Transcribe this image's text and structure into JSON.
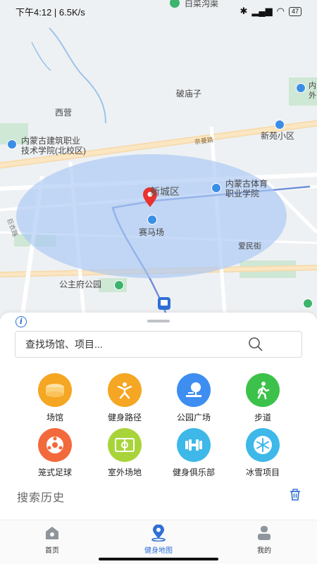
{
  "status": {
    "time_speed": "下午4:12 | 6.5K/s",
    "battery": "47"
  },
  "map": {
    "labels": {
      "top": "白菜沟渠",
      "xiying": "西营",
      "pomiaozi": "破庙子",
      "jianzhu": "内蒙古建筑职业\n技术学院(北校区)",
      "xinyuan": "新苑小区",
      "district": "新城区",
      "tiyu": "内蒙古体育\n职业学院",
      "saimachang": "赛马场",
      "gongzhufu": "公主府公园",
      "aimin": "爱民街",
      "neimeng_edge": "内\n外",
      "road": "奈曼路",
      "road2": "巨衣路"
    }
  },
  "sheet": {
    "search_placeholder": "查找场馆、项目...",
    "categories": [
      {
        "label": "场馆",
        "color": "#f5a623",
        "icon": "stadium-icon"
      },
      {
        "label": "健身路径",
        "color": "#f5a623",
        "icon": "fitness-path-icon"
      },
      {
        "label": "公园广场",
        "color": "#3d8ef0",
        "icon": "park-icon"
      },
      {
        "label": "步道",
        "color": "#3cc24a",
        "icon": "walking-icon"
      },
      {
        "label": "笼式足球",
        "color": "#f2693b",
        "icon": "football-icon"
      },
      {
        "label": "室外场地",
        "color": "#a8d43a",
        "icon": "outdoor-field-icon"
      },
      {
        "label": "健身俱乐部",
        "color": "#3db8e8",
        "icon": "dumbbell-icon"
      },
      {
        "label": "冰雪项目",
        "color": "#3db8e8",
        "icon": "snowflake-icon"
      }
    ],
    "history_title": "搜索历史"
  },
  "tabs": [
    {
      "label": "首页",
      "icon": "home-icon"
    },
    {
      "label": "健身地图",
      "icon": "map-pin-icon"
    },
    {
      "label": "我的",
      "icon": "profile-icon"
    }
  ],
  "colors": {
    "accent": "#2f6fd6",
    "radius_fill": "#a9c8f5"
  }
}
